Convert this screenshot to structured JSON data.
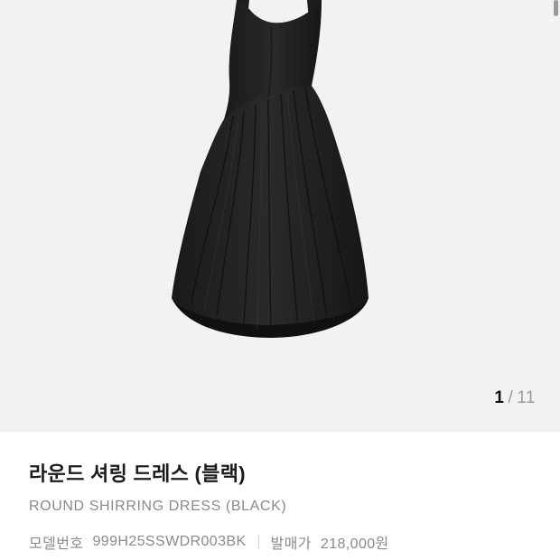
{
  "gallery": {
    "current": "1",
    "separator": "/",
    "total": "11"
  },
  "product": {
    "name": "라운드 셔링 드레스 (블랙)",
    "name_en": "ROUND SHIRRING DRESS (BLACK)",
    "model_label": "모델번호",
    "model_value": "999H25SSWDR003BK",
    "price_label": "발매가",
    "price_value": "218,000원"
  }
}
